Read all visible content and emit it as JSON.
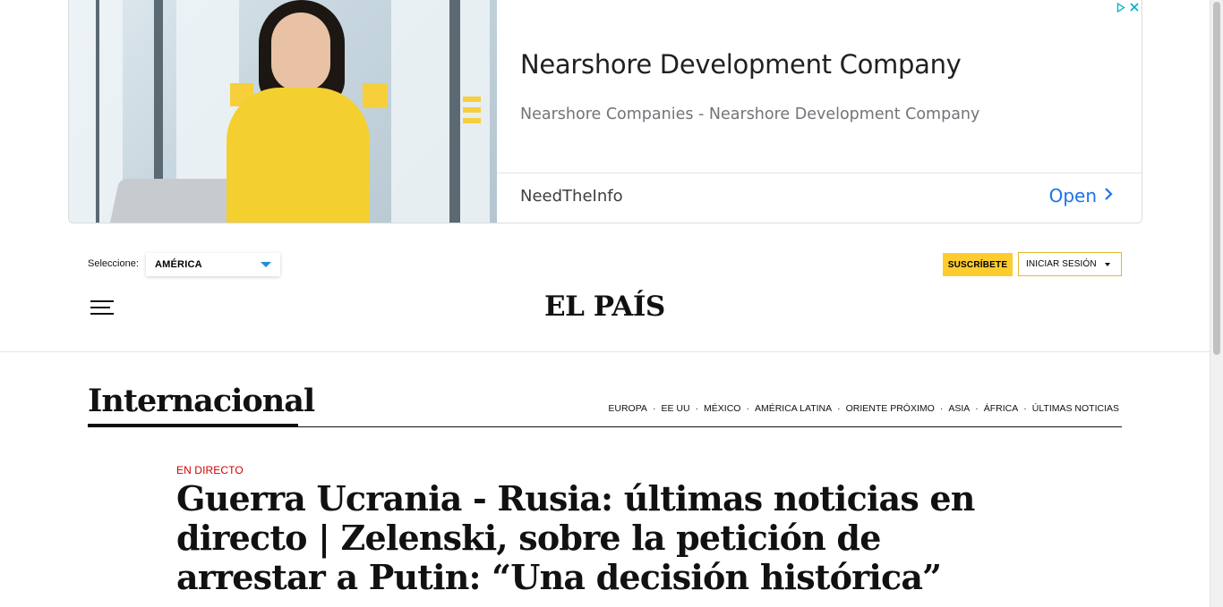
{
  "ad": {
    "title": "Nearshore Development Company",
    "description": "Nearshore Companies - Nearshore Development Company",
    "advertiser": "NeedTheInfo",
    "cta_label": "Open",
    "cta_icon": "chevron-right-icon",
    "adchoices_icon": "adchoices-icon",
    "close_icon": "close-icon",
    "accent_color": "#1a73e8"
  },
  "header": {
    "edition_label": "Seleccione:",
    "edition_value": "AMÉRICA",
    "subscribe_label": "SUSCRÍBETE",
    "login_label": "INICIAR SESIÓN",
    "logo": "EL PAÍS",
    "menu_icon": "hamburger-menu-icon",
    "subscribe_color": "#ffcc2e"
  },
  "section": {
    "title": "Internacional",
    "nav": [
      {
        "label": "EUROPA"
      },
      {
        "label": "EE UU"
      },
      {
        "label": "MÉXICO"
      },
      {
        "label": "AMÉRICA LATINA"
      },
      {
        "label": "ORIENTE PRÓXIMO"
      },
      {
        "label": "ASIA"
      },
      {
        "label": "ÁFRICA"
      },
      {
        "label": "ÚLTIMAS NOTICIAS"
      }
    ],
    "separator": "·"
  },
  "article": {
    "kicker": "EN DIRECTO",
    "kicker_color": "#d60000",
    "headline": "Guerra Ucrania - Rusia: últimas noticias en directo | Zelenski, sobre la petición de arrestar a Putin: “Una decisión histórica”"
  }
}
